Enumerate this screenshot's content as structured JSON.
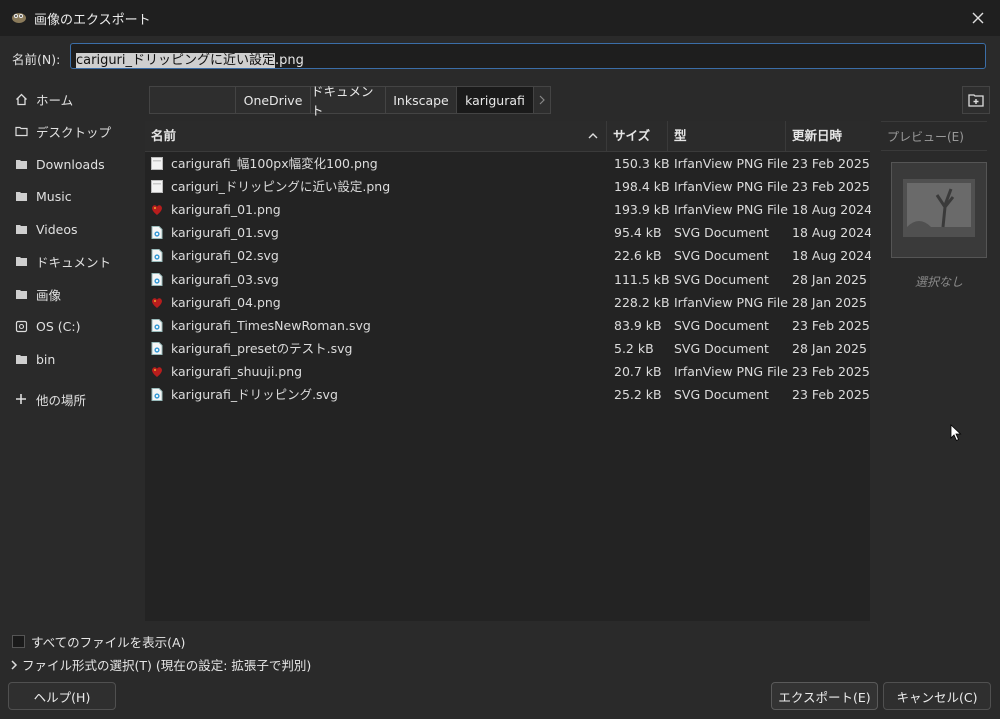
{
  "window": {
    "title": "画像のエクスポート"
  },
  "name_row": {
    "label": "名前(N):",
    "value_selected": "cariguri_ドリッピングに近い設定",
    "value_rest": ".png"
  },
  "sidebar": {
    "items": [
      {
        "label": "ホーム",
        "icon": "home-icon"
      },
      {
        "label": "デスクトップ",
        "icon": "folder-icon"
      },
      {
        "label": "Downloads",
        "icon": "folder-icon"
      },
      {
        "label": "Music",
        "icon": "folder-icon"
      },
      {
        "label": "Videos",
        "icon": "folder-icon"
      },
      {
        "label": "ドキュメント",
        "icon": "folder-icon"
      },
      {
        "label": "画像",
        "icon": "folder-icon"
      },
      {
        "label": "OS (C:)",
        "icon": "drive-icon"
      },
      {
        "label": "bin",
        "icon": "folder-icon"
      },
      {
        "label": "他の場所",
        "icon": "plus-icon"
      }
    ]
  },
  "breadcrumb": [
    "OneDrive",
    "ドキュメント",
    "Inkscape",
    "karigurafi"
  ],
  "columns": {
    "name": "名前",
    "size": "サイズ",
    "type": "型",
    "date": "更新日時"
  },
  "files": [
    {
      "name": "carigurafi_幅100px幅変化100.png",
      "size": "150.3 kB",
      "type": "IrfanView PNG File",
      "date": "23 Feb 2025",
      "icon": "png-white"
    },
    {
      "name": "cariguri_ドリッピングに近い設定.png",
      "size": "198.4 kB",
      "type": "IrfanView PNG File",
      "date": "23 Feb 2025",
      "icon": "png-white"
    },
    {
      "name": "karigurafi_01.png",
      "size": "193.9 kB",
      "type": "IrfanView PNG File",
      "date": "18 Aug 2024",
      "icon": "png-red"
    },
    {
      "name": "karigurafi_01.svg",
      "size": "95.4 kB",
      "type": "SVG Document",
      "date": "18 Aug 2024",
      "icon": "svg"
    },
    {
      "name": "karigurafi_02.svg",
      "size": "22.6 kB",
      "type": "SVG Document",
      "date": "18 Aug 2024",
      "icon": "svg"
    },
    {
      "name": "karigurafi_03.svg",
      "size": "111.5 kB",
      "type": "SVG Document",
      "date": "28 Jan 2025",
      "icon": "svg"
    },
    {
      "name": "karigurafi_04.png",
      "size": "228.2 kB",
      "type": "IrfanView PNG File",
      "date": "28 Jan 2025",
      "icon": "png-red"
    },
    {
      "name": "karigurafi_TimesNewRoman.svg",
      "size": "83.9 kB",
      "type": "SVG Document",
      "date": "23 Feb 2025",
      "icon": "svg"
    },
    {
      "name": "karigurafi_presetのテスト.svg",
      "size": "5.2 kB",
      "type": "SVG Document",
      "date": "28 Jan 2025",
      "icon": "svg"
    },
    {
      "name": "karigurafi_shuuji.png",
      "size": "20.7 kB",
      "type": "IrfanView PNG File",
      "date": "23 Feb 2025",
      "icon": "png-red"
    },
    {
      "name": "karigurafi_ドリッピング.svg",
      "size": "25.2 kB",
      "type": "SVG Document",
      "date": "23 Feb 2025",
      "icon": "svg"
    }
  ],
  "preview": {
    "title": "プレビュー(E)",
    "none_label": "選択なし"
  },
  "options": {
    "show_all_files": "すべてのファイルを表示(A)",
    "file_type": "ファイル形式の選択(T) (現在の設定: 拡張子で判別)"
  },
  "buttons": {
    "help": "ヘルプ(H)",
    "export": "エクスポート(E)",
    "cancel": "キャンセル(C)"
  },
  "colors": {
    "accent": "#3b6ea8",
    "background": "#2a2a2a",
    "list_bg": "#232323"
  }
}
